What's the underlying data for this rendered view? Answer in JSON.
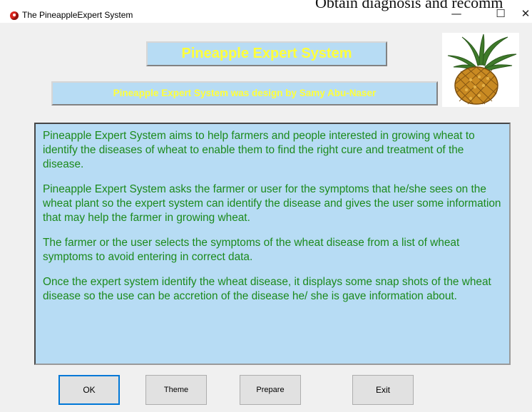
{
  "overlay": {
    "text": "Obtain diagnosis and recomm"
  },
  "window": {
    "title": "The PineappleExpert System",
    "minimize_glyph": "—",
    "maximize_glyph": "☐",
    "close_glyph": "✕"
  },
  "header": {
    "title": "Pineapple Expert System",
    "subtitle": "Pineapple Expert System was design by Samy Abu-Naser"
  },
  "description": {
    "paragraphs": [
      "Pineapple Expert System aims to help farmers and people interested in growing wheat to identify the diseases of wheat to enable them to find the right cure and treatment of the disease.",
      "Pineapple Expert System asks the farmer or user for the symptoms that  he/she sees on the wheat plant so the expert system can identify the disease and gives the user some information that may help the farmer in growing wheat.",
      "The farmer or the user selects the symptoms of the wheat disease from a list of wheat symptoms to avoid entering in correct data.",
      "Once the expert  system identify the wheat disease, it displays some snap shots of the wheat disease so the use can be accretion of the disease he/ she is gave information  about."
    ]
  },
  "buttons": {
    "ok": "OK",
    "theme": "Theme",
    "prepare": "Prepare",
    "exit": "Exit"
  },
  "colors": {
    "banner_bg": "#b7dcf4",
    "banner_text": "#ffff3a",
    "description_text": "#1c8a1c",
    "focus_border": "#0078d7"
  },
  "icons": {
    "app": "app-icon",
    "image": "pineapple-image"
  }
}
